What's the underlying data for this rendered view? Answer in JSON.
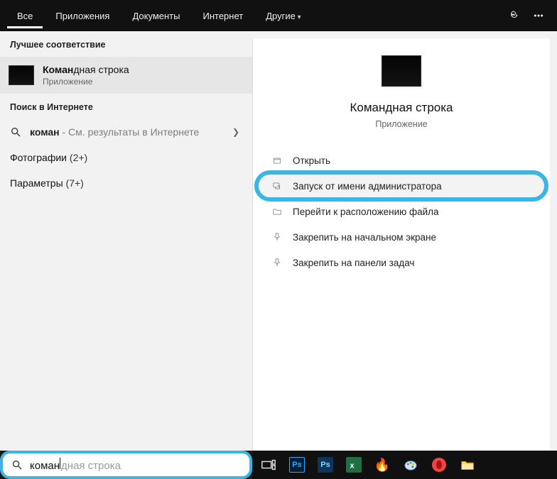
{
  "tabs": {
    "all": "Все",
    "apps": "Приложения",
    "docs": "Документы",
    "internet": "Интернет",
    "more": "Другие"
  },
  "left": {
    "best_match_header": "Лучшее соответствие",
    "best_item": {
      "title_bold": "Коман",
      "title_rest": "дная строка",
      "subtitle": "Приложение"
    },
    "internet_header": "Поиск в Интернете",
    "internet_row": {
      "query_bold": "коман",
      "hint": " - См. результаты в Интернете"
    },
    "photos_label": "Фотографии",
    "photos_count": "(2+)",
    "settings_label": "Параметры",
    "settings_count": "(7+)"
  },
  "right": {
    "title": "Командная строка",
    "subtitle": "Приложение",
    "actions": {
      "open": "Открыть",
      "run_admin": "Запуск от имени администратора",
      "open_loc": "Перейти к расположению файла",
      "pin_start": "Закрепить на начальном экране",
      "pin_taskbar": "Закрепить на панели задач"
    }
  },
  "search": {
    "typed": "коман",
    "suggestion_rest": "дная строка"
  },
  "taskbar": {
    "ps": "Ps",
    "xl": "x"
  }
}
